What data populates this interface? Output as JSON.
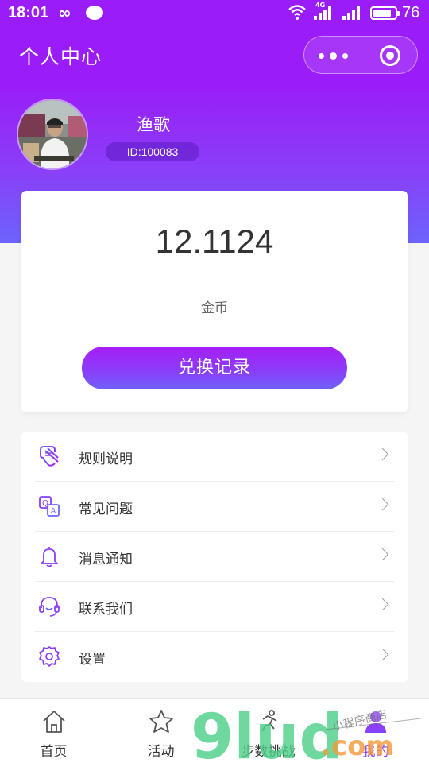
{
  "status_bar": {
    "time": "18:01",
    "loop_symbol": "∞",
    "network": "4G",
    "battery": "76"
  },
  "nav": {
    "title": "个人中心"
  },
  "profile": {
    "name": "渔歌",
    "id_text": "ID:100083"
  },
  "coins": {
    "value": "12.1124",
    "label": "金币",
    "button_label": "兑换记录"
  },
  "menu": {
    "items": [
      {
        "label": "规则说明",
        "icon": "rules-icon"
      },
      {
        "label": "常见问题",
        "icon": "faq-icon"
      },
      {
        "label": "消息通知",
        "icon": "bell-icon"
      },
      {
        "label": "联系我们",
        "icon": "headset-icon"
      },
      {
        "label": "设置",
        "icon": "gear-icon"
      }
    ]
  },
  "tabbar": {
    "tabs": [
      {
        "label": "首页",
        "icon": "home-icon"
      },
      {
        "label": "活动",
        "icon": "star-icon"
      },
      {
        "label": "步数挑战",
        "icon": "running-icon"
      },
      {
        "label": "我的",
        "icon": "user-icon",
        "active": true
      }
    ]
  },
  "watermark": {
    "brand": "9lud",
    "domain": ".com",
    "tagline": "小程序商店"
  },
  "colors": {
    "primary": "#9a1cf8",
    "gradient_end": "#6c63fc",
    "background": "#f5f5f5"
  }
}
